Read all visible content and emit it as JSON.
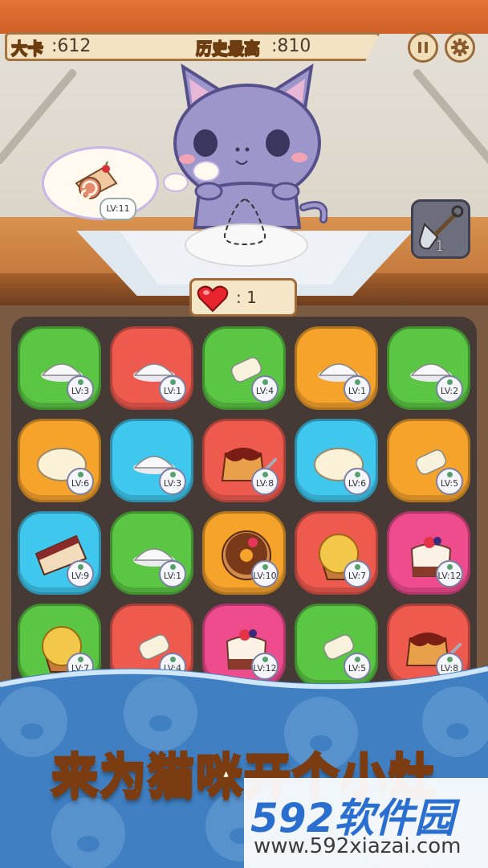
{
  "hud": {
    "player_label": "大卡",
    "player_value": ":612",
    "best_label": "历史最高",
    "best_value": ":810",
    "pause_icon": "pause-icon",
    "settings_icon": "gear-icon"
  },
  "order": {
    "item": "cake-roll",
    "level": "LV:11"
  },
  "tools": {
    "shovel_count": "1"
  },
  "lives": {
    "icon": "heart-icon",
    "count": ": 1"
  },
  "colors": {
    "green": "#5bc544",
    "red": "#ee5a4e",
    "orange": "#f6a32c",
    "blue": "#3fc7ee",
    "pink": "#ef4c8e"
  },
  "board": [
    [
      {
        "color": "green",
        "item": "flour",
        "level": "LV:3"
      },
      {
        "color": "red",
        "item": "flour",
        "level": "LV:1"
      },
      {
        "color": "green",
        "item": "butter",
        "level": "LV:4"
      },
      {
        "color": "orange",
        "item": "flour",
        "level": "LV:1"
      },
      {
        "color": "green",
        "item": "flour",
        "level": "LV:2"
      }
    ],
    [
      {
        "color": "orange",
        "item": "dough",
        "level": "LV:6"
      },
      {
        "color": "blue",
        "item": "flour",
        "level": "LV:3"
      },
      {
        "color": "red",
        "item": "pudding",
        "level": "LV:8"
      },
      {
        "color": "blue",
        "item": "dough",
        "level": "LV:6"
      },
      {
        "color": "orange",
        "item": "butter",
        "level": "LV:5"
      }
    ],
    [
      {
        "color": "blue",
        "item": "cake-slice",
        "level": "LV:9"
      },
      {
        "color": "green",
        "item": "flour",
        "level": "LV:1"
      },
      {
        "color": "orange",
        "item": "donut",
        "level": "LV:10"
      },
      {
        "color": "red",
        "item": "muffin",
        "level": "LV:7"
      },
      {
        "color": "pink",
        "item": "berry-cake",
        "level": "LV:12"
      }
    ],
    [
      {
        "color": "green",
        "item": "muffin",
        "level": "LV:7"
      },
      {
        "color": "red",
        "item": "butter",
        "level": "LV:4"
      },
      {
        "color": "pink",
        "item": "berry-cake",
        "level": "LV:12"
      },
      {
        "color": "green",
        "item": "butter",
        "level": "LV:5"
      },
      {
        "color": "red",
        "item": "pudding",
        "level": "LV:8"
      }
    ]
  ],
  "banner": {
    "headline": "来为猫咪开个小灶",
    "watermark_title": "592软件园",
    "watermark_url": "www.592xiazai.com"
  }
}
